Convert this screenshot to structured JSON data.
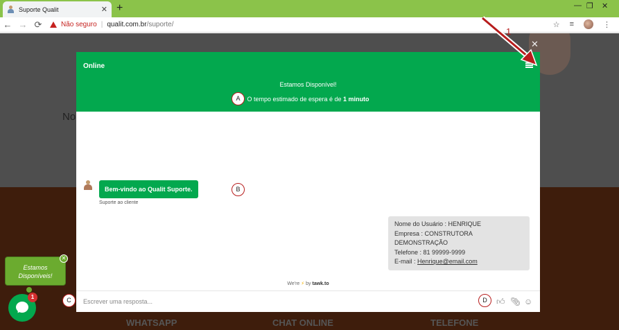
{
  "browser": {
    "tab_title": "Suporte Qualit",
    "new_tab": "+",
    "tab_close": "✕",
    "minimize": "—",
    "restore": "❐",
    "close": "✕",
    "back": "←",
    "forward": "→",
    "reload": "⟳",
    "not_secure": "Não seguro",
    "separator": "|",
    "url_host": "qualit.com.br",
    "url_path": "/suporte/",
    "star": "☆",
    "menu": "⋮",
    "reading_list": "≡"
  },
  "page": {
    "partial_heading": "No",
    "footer_links": [
      "WHATSAPP",
      "CHAT ONLINE",
      "TELEFONE"
    ]
  },
  "modal": {
    "close": "✕",
    "status": "Online",
    "available": "Estamos Disponível!",
    "wait_prefix": "O tempo estimado de espera é de",
    "wait_value": "1 minuto",
    "agent_message": "Bem-vindo ao Qualit Suporte.",
    "agent_label": "Suporte ao cliente",
    "user_message": {
      "line1": "Nome do Usuário : HENRIQUE",
      "line2": "Empresa : CONSTRUTORA DEMONSTRAÇÃO",
      "line3": "Telefone : 81 99999-9999",
      "email_label": "E-mail :",
      "email_value": "Henrique@email.com"
    },
    "powered_prefix": "We're",
    "powered_by": "by",
    "powered_brand": "tawk.to",
    "composer_placeholder": "Escrever uma resposta..."
  },
  "callouts": {
    "a": "A",
    "b": "B",
    "c": "C",
    "d": "D",
    "one": "1"
  },
  "widget": {
    "popup_line1": "Estamos",
    "popup_line2": "Disponíveis!",
    "popup_close": "✕",
    "badge": "1"
  },
  "colors": {
    "tawk_green": "#03a84e",
    "chrome_tab_bar": "#8bc34a",
    "annotation_red": "#b71c1c"
  }
}
